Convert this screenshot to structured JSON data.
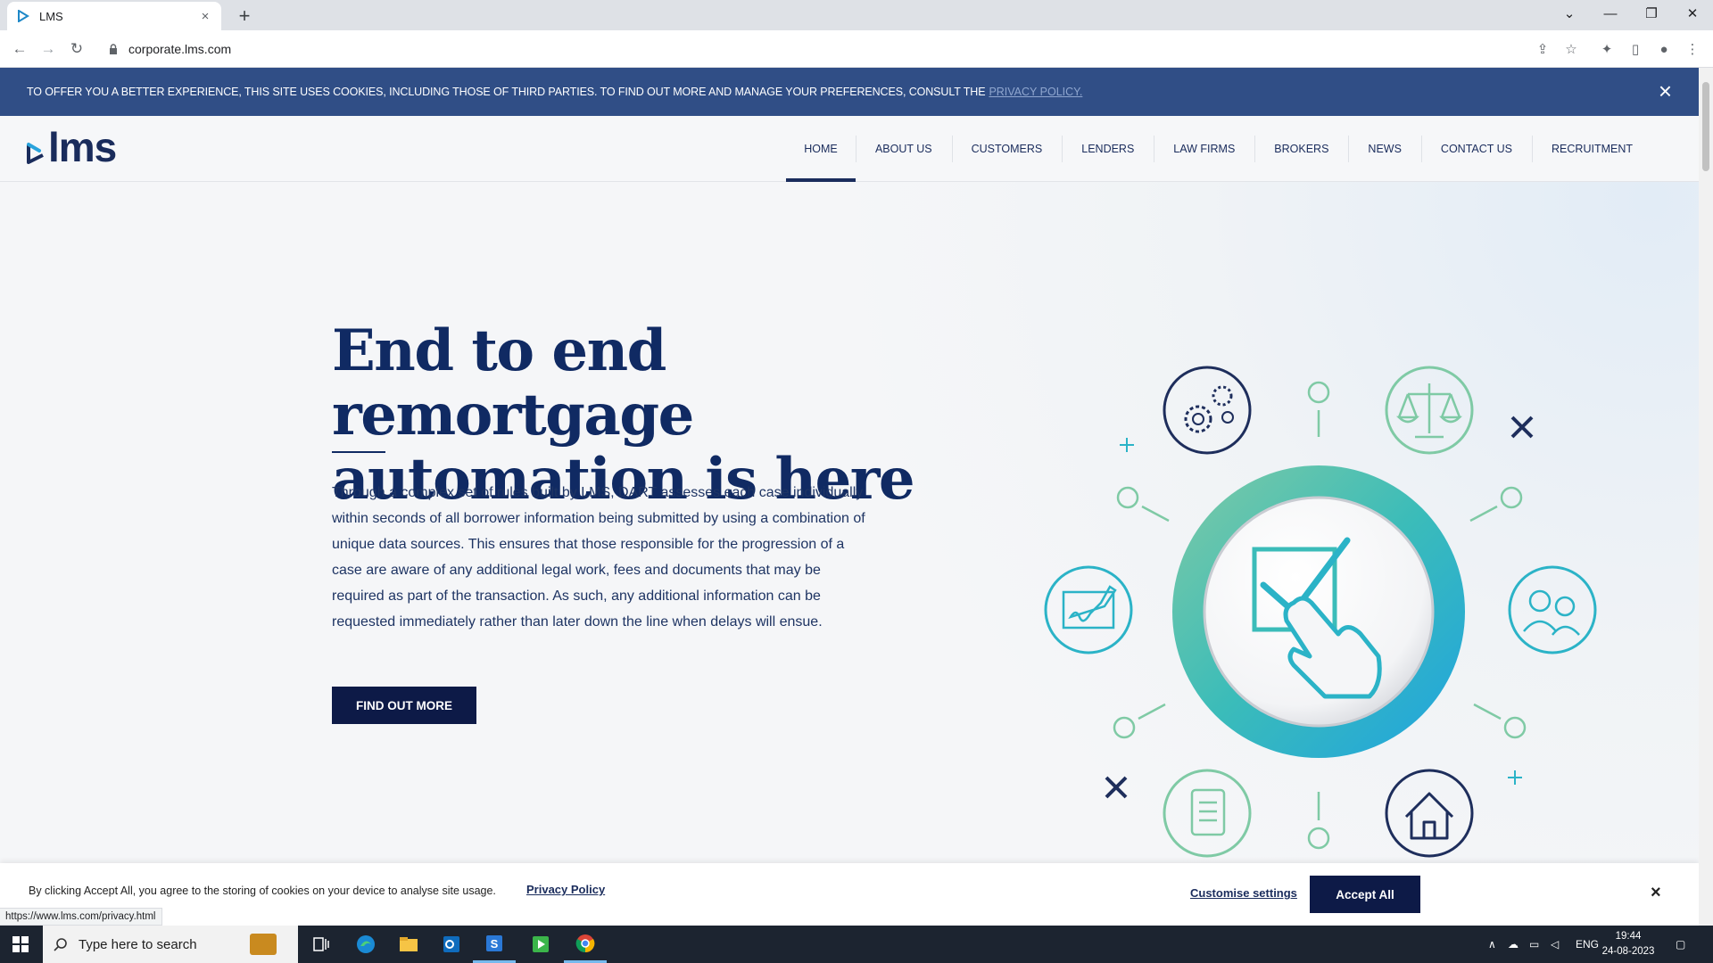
{
  "browser": {
    "tab_title": "LMS",
    "tab_close": "×",
    "new_tab": "+",
    "url": "corporate.lms.com",
    "status_url": "https://www.lms.com/privacy.html"
  },
  "cookie_top": {
    "message": "TO OFFER YOU A BETTER EXPERIENCE, THIS SITE USES COOKIES, INCLUDING THOSE OF THIRD PARTIES. TO FIND OUT MORE AND MANAGE YOUR PREFERENCES, CONSULT THE",
    "link": "PRIVACY POLICY.",
    "close": "×"
  },
  "header": {
    "logo_text": "lms",
    "nav": [
      {
        "label": "HOME"
      },
      {
        "label": "ABOUT US"
      },
      {
        "label": "CUSTOMERS"
      },
      {
        "label": "LENDERS"
      },
      {
        "label": "LAW FIRMS"
      },
      {
        "label": "BROKERS"
      },
      {
        "label": "NEWS"
      },
      {
        "label": "CONTACT US"
      },
      {
        "label": "RECRUITMENT"
      }
    ]
  },
  "hero": {
    "headline_line1": "End to end remortgage",
    "headline_line2": "automation is here",
    "body": "Through a complex set of rules built by LMS, DART assesses each case individually within seconds of all borrower information being submitted by using a combination of unique data sources. This ensures that those responsible for the progression of a case are aware of any additional legal work, fees and documents that may be required as part of the transaction. As such, any additional information can be requested immediately rather than later down the line when delays will ensue.",
    "cta": "FIND OUT MORE"
  },
  "cookie_bottom": {
    "text": "By clicking Accept All, you agree to the storing of cookies on your device to analyse site usage.",
    "privacy_link": "Privacy Policy",
    "customise": "Customise settings",
    "accept": "Accept All",
    "close": "×"
  },
  "taskbar": {
    "search_placeholder": "Type here to search",
    "language": "ENG",
    "time": "19:44",
    "date": "24-08-2023"
  },
  "colors": {
    "brand_navy": "#102a63",
    "cookie_bar": "#304e86",
    "button_dark": "#0d1a47",
    "accent_teal": "#2bb3c7",
    "accent_green": "#7fcaa5"
  }
}
